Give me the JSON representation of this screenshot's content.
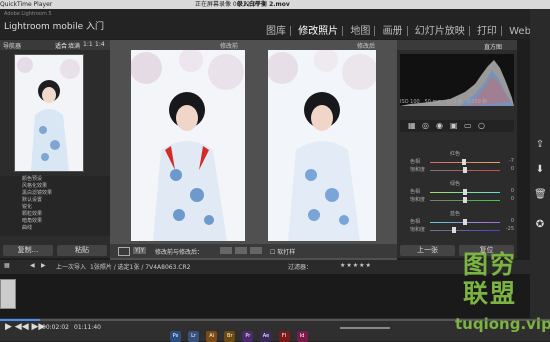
{
  "menubar": {
    "app": "QuickTime Player",
    "recording": "正在屏幕录像 00:12:09",
    "file": "录入白平衡 2.mov"
  },
  "lightroom": {
    "small_title": "Adobe Lightroom 5",
    "title": "Lightroom mobile 入门",
    "modules": [
      "图库",
      "修改照片",
      "地图",
      "画册",
      "幻灯片放映",
      "打印",
      "Web"
    ],
    "active_module": "修改照片"
  },
  "left_panel": {
    "header": "导航器",
    "zoom_opts": [
      "适合",
      "填满",
      "1:1",
      "1:4"
    ],
    "presets": [
      "颜色预设",
      "风格化效果",
      "黑白滤镜效果",
      "默认设置",
      "锐化",
      "颗粒效果",
      "暗角效果",
      "曲线"
    ],
    "copy_button": "复制...",
    "paste_button": "粘贴"
  },
  "center": {
    "before_label": "修改前",
    "after_label": "修改后",
    "toolbar_label": "修改前与修改后：",
    "view_mode": "Y|Y"
  },
  "right_panel": {
    "header": "直方图",
    "hist_info": [
      "ISO 100",
      "50 mm",
      "f / 1.8",
      "1/200 秒"
    ],
    "hsl_groups": [
      {
        "name": "红色",
        "rows": [
          {
            "label": "色相",
            "value": "-7"
          },
          {
            "label": "饱和度",
            "value": "0"
          }
        ]
      },
      {
        "name": "绿色",
        "rows": [
          {
            "label": "色相",
            "value": "0"
          },
          {
            "label": "饱和度",
            "value": "0"
          }
        ]
      },
      {
        "name": "蓝色",
        "rows": [
          {
            "label": "色相",
            "value": "0"
          },
          {
            "label": "饱和度",
            "value": "-25"
          }
        ]
      }
    ],
    "prev_button": "上一张",
    "reset_button": "复位"
  },
  "filmbar": {
    "prev_import": "上一次导入",
    "path": "1张照片 / 选定1张 / 7V4A8063.CR2",
    "filter": "过滤器："
  },
  "player": {
    "current": "00:02:02",
    "total": "01:11:40"
  },
  "watermark": {
    "line1": "图穷",
    "line2": "联盟",
    "site": "tuqiong.vip"
  },
  "dock_icons": [
    "Ps",
    "Lr",
    "Ai",
    "Br",
    "Pr",
    "Ae",
    "Fl",
    "Id"
  ]
}
